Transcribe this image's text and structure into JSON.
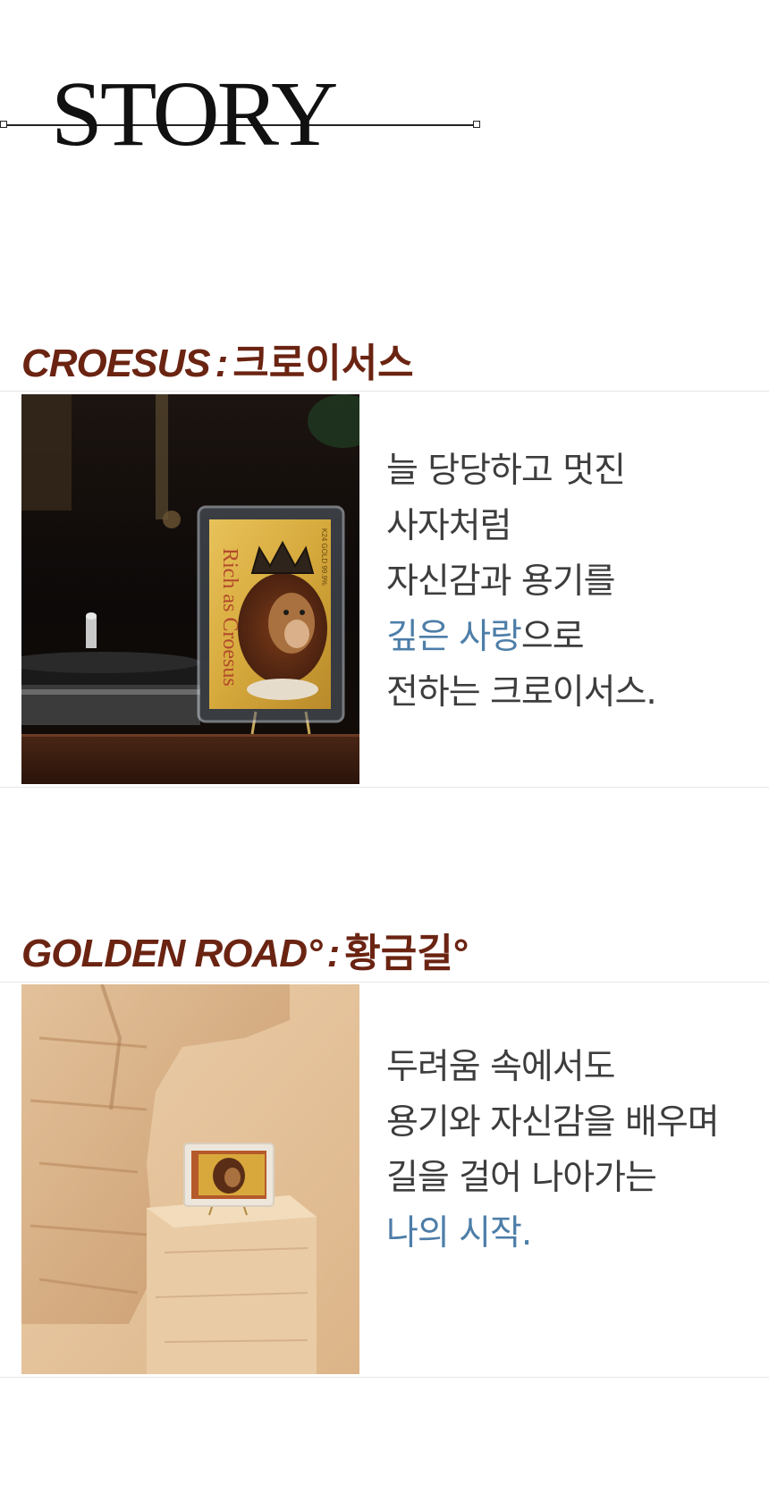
{
  "header": {
    "title": "STORY"
  },
  "sections": [
    {
      "title_en": "CROESUS",
      "separator": ":",
      "title_ko": "크로이서스",
      "photo": {
        "card_text": "Rich as Croesus",
        "card_side_text": "K24 GOLD 99.9%"
      },
      "lines": [
        {
          "text": "늘 당당하고 멋진"
        },
        {
          "text": "사자처럼"
        },
        {
          "text": "자신감과 용기를"
        },
        {
          "highlight": "깊은 사랑",
          "text": "으로"
        },
        {
          "text": "전하는 크로이서스."
        }
      ]
    },
    {
      "title_en": "GOLDEN ROAD°",
      "separator": ":",
      "title_ko": "황금길°",
      "photo": {},
      "lines": [
        {
          "text": "두려움 속에서도"
        },
        {
          "text": "용기와 자신감을 배우며"
        },
        {
          "text": "길을 걸어 나아가는"
        },
        {
          "highlight": "나의 시작."
        }
      ]
    }
  ],
  "colors": {
    "title": "#6b2412",
    "body_text": "#3d3d3d",
    "highlight": "#4d7ea8",
    "rule": "#e6e6e6"
  }
}
